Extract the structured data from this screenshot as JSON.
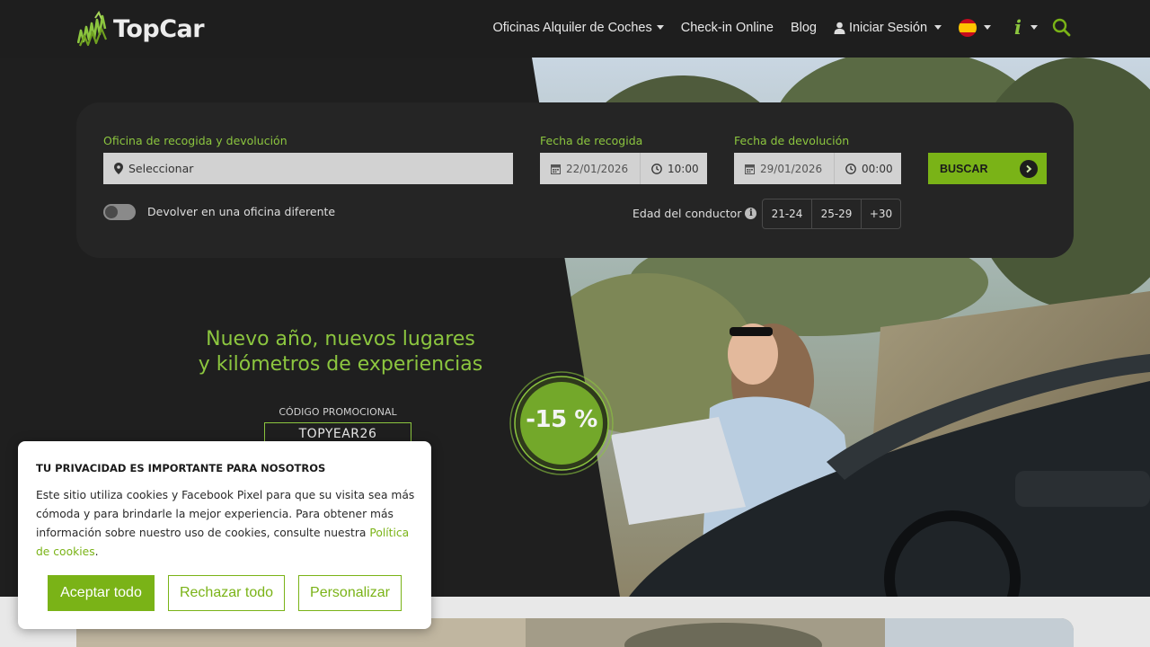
{
  "brand": {
    "name": "TopCar"
  },
  "nav": {
    "offices": "Oficinas Alquiler de Coches",
    "checkin": "Check-in Online",
    "blog": "Blog",
    "login": "Iniciar Sesión"
  },
  "search": {
    "office_label": "Oficina de recogida y devolución",
    "office_value": "Seleccionar",
    "pickup_label": "Fecha de recogida",
    "pickup_date": "22/01/2026",
    "pickup_time": "10:00",
    "return_label": "Fecha de devolución",
    "return_date": "29/01/2026",
    "return_time": "00:00",
    "search_button": "BUSCAR",
    "different_office": "Devolver en una oficina diferente",
    "driver_age_label": "Edad del conductor",
    "age_options": [
      "21-24",
      "25-29",
      "+30"
    ]
  },
  "promo": {
    "line1": "Nuevo año, nuevos lugares",
    "line2": "y kilómetros de experiencias",
    "code_label": "CÓDIGO PROMOCIONAL",
    "code": "TOPYEAR26",
    "discount": "-15 %"
  },
  "cookie": {
    "title": "TU PRIVACIDAD ES IMPORTANTE PARA NOSOTROS",
    "body": "Este sitio utiliza cookies y Facebook Pixel para que su visita sea más cómoda y para brindarle la mejor experiencia. Para obtener más información sobre nuestro uso de cookies, consulte nuestra ",
    "link": "Política de cookies",
    "end": ".",
    "accept": "Aceptar todo",
    "reject": "Rechazar todo",
    "customize": "Personalizar"
  },
  "colors": {
    "accent": "#7ab317",
    "accent_light": "#8cc63f",
    "panel": "#252525",
    "header": "#1e1e1e"
  }
}
